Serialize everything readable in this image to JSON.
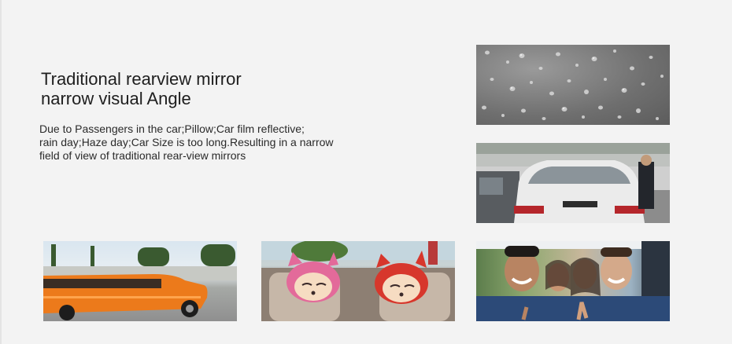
{
  "headline": {
    "line1": "Traditional rearview mirror",
    "line2": "narrow visual Angle"
  },
  "description": {
    "line1": "Due to Passengers in the car;Pillow;Car film reflective;",
    "line2": "rain day;Haze day;Car Size is too long.Resulting in a narrow",
    "line3": "field of view of traditional rear-view mirrors"
  },
  "photos": [
    {
      "name": "raindrops-on-glass-photo"
    },
    {
      "name": "car-rear-view-photo"
    },
    {
      "name": "orange-limousine-photo"
    },
    {
      "name": "plush-toys-headrest-photo"
    },
    {
      "name": "passengers-in-car-photo"
    }
  ],
  "colors": {
    "background": "#f3f3f3",
    "text": "#1e1e1e"
  }
}
